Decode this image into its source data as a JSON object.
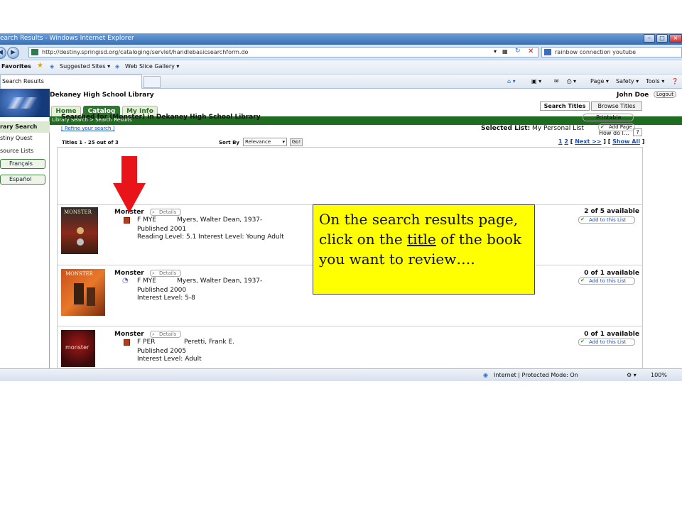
{
  "browser": {
    "window_title": "earch Results - Windows Internet Explorer",
    "url": "http://destiny.springisd.org/cataloging/servlet/handlebasicsearchform.do",
    "search_text": "rainbow connection youtube",
    "favorites_label": "Favorites",
    "suggested_sites_label": "Suggested Sites ▾",
    "web_slice_label": "Web Slice Gallery ▾",
    "tab_title": "Search Results",
    "cmd_page": "Page ▾",
    "cmd_safety": "Safety ▾",
    "cmd_tools": "Tools ▾",
    "status_zone": "Internet | Protected Mode: On",
    "zoom": "100%"
  },
  "header": {
    "library_name": "Dekaney High School Library",
    "user_name": "John Doe",
    "logout_label": "Logout",
    "nav_tabs": [
      "Home",
      "Catalog",
      "My Info"
    ],
    "breadcrumb": "Library Search > Search Results",
    "how_do_i": "How do I...",
    "help_glyph": "?"
  },
  "sidebar": {
    "items": [
      "rary Search",
      "stiny Quest",
      "source Lists"
    ],
    "lang_buttons": [
      "Français",
      "Español"
    ]
  },
  "search": {
    "tabs": [
      "Search Titles",
      "Browse Titles"
    ],
    "searched_for": "Searched for (Monster) in Dekaney High School Library",
    "refine": "[ Refine your search ]",
    "printable": "Printable",
    "selected_list_label": "Selected List:",
    "selected_list_value": "My Personal List",
    "add_page": "Add Page",
    "titles_count": "Titles 1 - 25 out of 3",
    "sort_by": "Sort By",
    "sort_value": "Relevance",
    "go": "Go!",
    "paging_pages": "1",
    "paging_page2": "2",
    "paging_next": "Next >>",
    "paging_show_all": "Show All"
  },
  "results": [
    {
      "title": "Monster",
      "details": "Details",
      "call_no": "F MYE",
      "author": "Myers, Walter Dean, 1937-",
      "published": "Published 2001",
      "levels": "Reading Level: 5.1  Interest Level: Young Adult",
      "availability": "2 of 5 available",
      "add_list": "Add to this List",
      "cover_text": "MONSTER"
    },
    {
      "title": "Monster",
      "details": "Details",
      "call_no": "F MYE",
      "author": "Myers, Walter Dean, 1937-",
      "published": "Published 2000",
      "levels": "Interest Level: 5-8",
      "availability": "0 of 1 available",
      "add_list": "Add to this List",
      "cover_text": "MONSTER"
    },
    {
      "title": "Monster",
      "details": "Details",
      "call_no": "F PER",
      "author": "Peretti, Frank E.",
      "published": "Published 2005",
      "levels": "Interest Level: Adult",
      "availability": "0 of 1 available",
      "add_list": "Add to this List",
      "cover_text": "monster"
    }
  ],
  "callout": {
    "text_before": "On the search results page, click on the ",
    "text_link": "title",
    "text_after": " of the book you want to review…."
  },
  "colors": {
    "callout_bg": "#ffff00",
    "arrow": "#e8141a",
    "nav_green": "#1f6b1f",
    "link_blue": "#1a4fb3"
  }
}
